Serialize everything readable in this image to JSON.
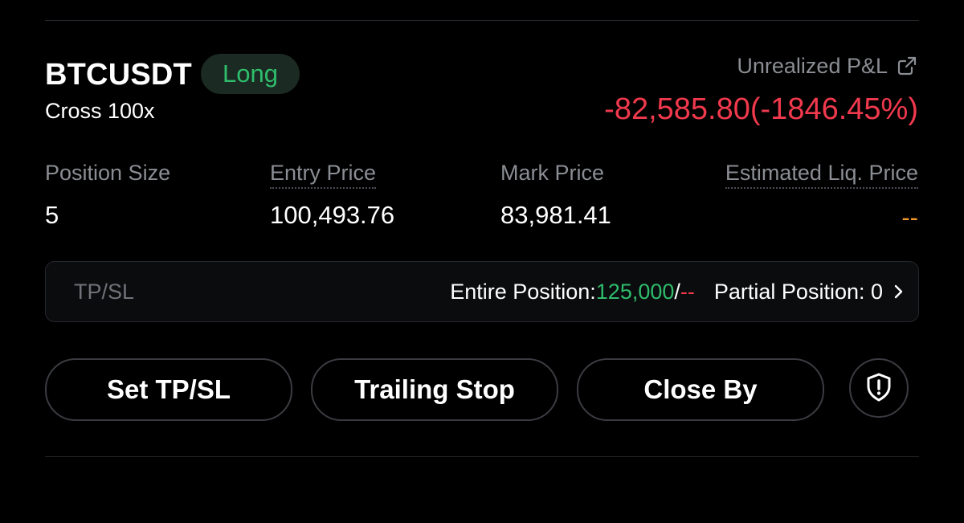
{
  "position": {
    "symbol": "BTCUSDT",
    "side": "Long",
    "margin_mode": "Cross 100x",
    "unrealized_pnl_label": "Unrealized P&L",
    "unrealized_pnl_value": "-82,585.80(-1846.45%)"
  },
  "stats": [
    {
      "label": "Position Size",
      "value": "5"
    },
    {
      "label": "Entry Price",
      "value": "100,493.76"
    },
    {
      "label": "Mark Price",
      "value": "83,981.41"
    },
    {
      "label": "Estimated Liq. Price",
      "value": "--"
    }
  ],
  "tpsl": {
    "title": "TP/SL",
    "entire_label": "Entire Position: ",
    "tp_value": "125,000",
    "separator": "/",
    "sl_value": "--",
    "partial_label": "Partial Position: 0"
  },
  "actions": {
    "set_tpsl": "Set TP/SL",
    "trailing_stop": "Trailing Stop",
    "close_by": "Close By"
  },
  "icons": {
    "share": "external-link-icon",
    "chevron": "chevron-right-icon",
    "shield": "shield-alert-icon"
  },
  "colors": {
    "long_green": "#2fbd6c",
    "loss_red": "#f0394d",
    "liq_orange": "#f39a2c"
  }
}
